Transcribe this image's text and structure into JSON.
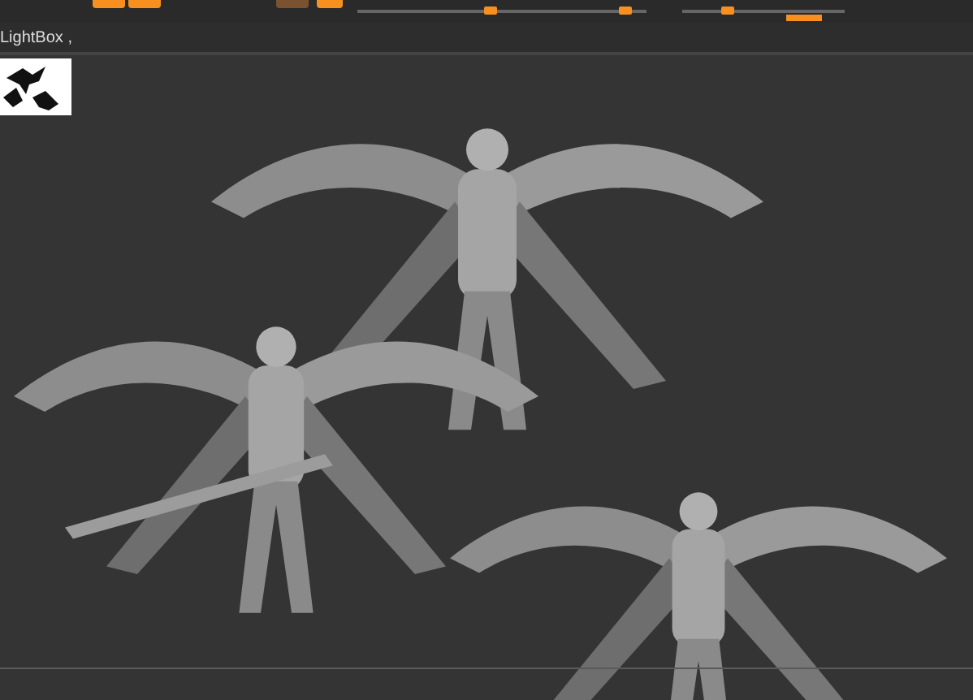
{
  "toolbar": {
    "buttons": [
      {
        "color": "#f7901e"
      },
      {
        "color": "#f7901e"
      },
      {
        "color": "#7a5230"
      },
      {
        "color": "#f7901e"
      }
    ],
    "sliders": [
      {
        "level": 0.93
      },
      {
        "level": 0.9
      },
      {
        "level": 0.32
      }
    ]
  },
  "lightbox": {
    "label": "LightBox ,"
  }
}
